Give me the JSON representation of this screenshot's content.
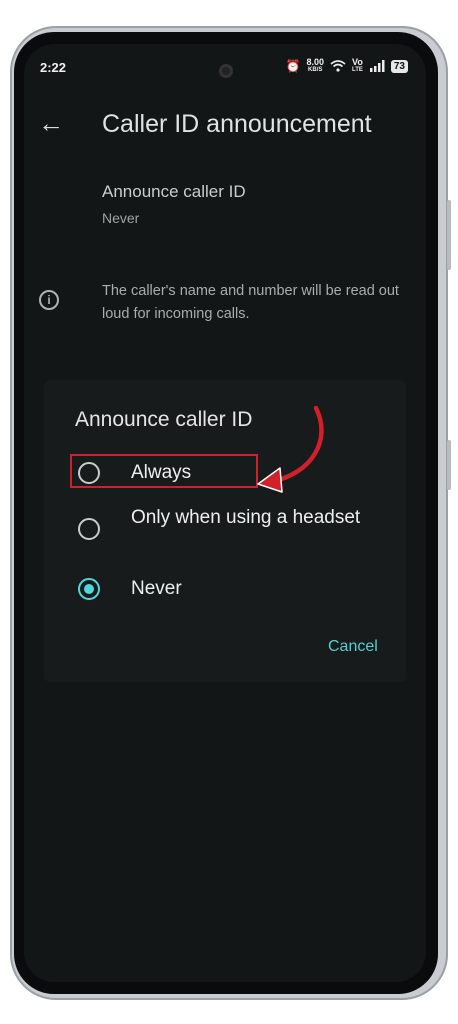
{
  "status_bar": {
    "time": "2:22",
    "speed": "8.00",
    "speed_unit": "KB/S",
    "volte": "Vo",
    "lte": "LTE",
    "battery": "73"
  },
  "app_bar": {
    "title": "Caller ID announcement"
  },
  "setting": {
    "title": "Announce caller ID",
    "value": "Never"
  },
  "info": {
    "text": "The caller's name and number will be read out loud for incoming calls."
  },
  "dialog": {
    "title": "Announce caller ID",
    "options": [
      {
        "label": "Always",
        "selected": false
      },
      {
        "label": "Only when using a headset",
        "selected": false
      },
      {
        "label": "Never",
        "selected": true
      }
    ],
    "cancel_label": "Cancel"
  },
  "colors": {
    "accent": "#4fd8dc",
    "annotation": "#d1202a",
    "background": "#121617"
  }
}
